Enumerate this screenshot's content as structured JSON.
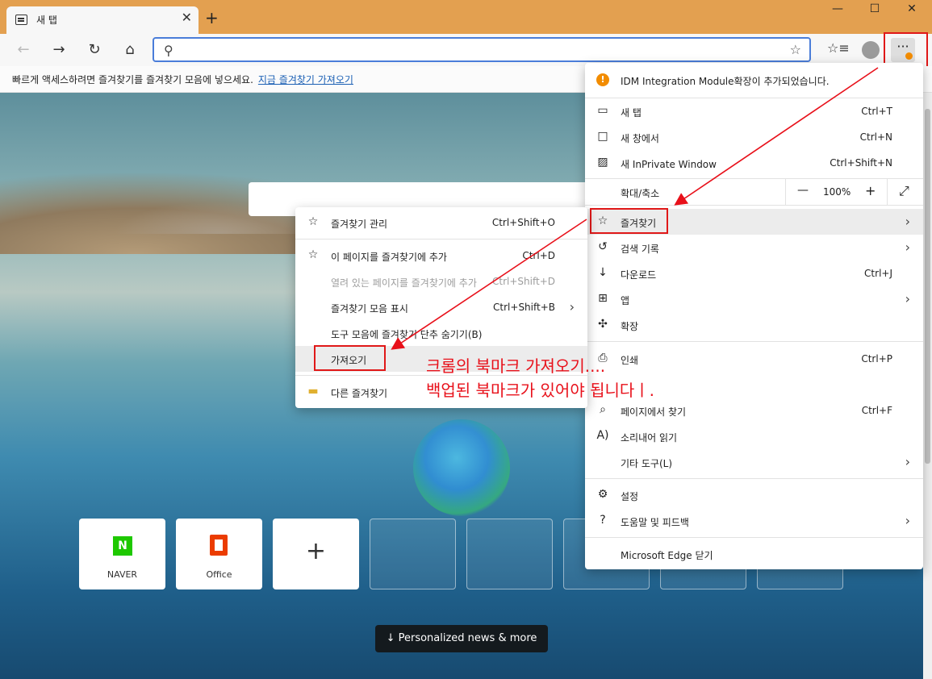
{
  "window": {
    "tab_title": "새 탭",
    "close": "✕",
    "new_tab": "+",
    "minimize": "—",
    "maximize": "☐",
    "close_window": "✕"
  },
  "toolbar": {
    "address_value": "",
    "more": "···"
  },
  "favorites_bar": {
    "message": "빠르게 액세스하려면 즐겨찾기를 즐겨찾기 모음에 넣으세요.",
    "link": "지금 즐겨찾기 가져오기"
  },
  "tiles": [
    {
      "label": "NAVER",
      "logo_text": "N"
    },
    {
      "label": "Office"
    },
    {
      "label": "+"
    }
  ],
  "news_button": "↓  Personalized news & more",
  "main_menu": {
    "notification": "IDM Integration Module확장이 추가되었습니다.",
    "items": [
      {
        "label": "새 탭",
        "shortcut": "Ctrl+T",
        "icon": "new-tab-icon"
      },
      {
        "label": "새 창에서",
        "shortcut": "Ctrl+N",
        "icon": "window-icon"
      },
      {
        "label": "새 InPrivate Window",
        "shortcut": "Ctrl+Shift+N",
        "icon": "inprivate-icon"
      },
      {
        "label": "확대/축소",
        "zoom_minus": "—",
        "zoom_value": "100%",
        "zoom_plus": "+",
        "fullscreen": "⤢"
      },
      {
        "label": "즐겨찾기",
        "icon": "favorites-icon"
      },
      {
        "label": "검색 기록",
        "icon": "history-icon"
      },
      {
        "label": "다운로드",
        "shortcut": "Ctrl+J",
        "icon": "download-icon"
      },
      {
        "label": "앱",
        "icon": "apps-icon"
      },
      {
        "label": "확장",
        "icon": "extensions-icon"
      },
      {
        "label": "인쇄",
        "shortcut": "Ctrl+P",
        "icon": "print-icon"
      },
      {
        "label": "페이지에서 찾기",
        "shortcut": "Ctrl+F",
        "icon": "find-icon"
      },
      {
        "label": "소리내어 읽기",
        "icon": "read-aloud-icon"
      },
      {
        "label": "기타 도구(L)"
      },
      {
        "label": "설정",
        "icon": "settings-icon"
      },
      {
        "label": "도움말 및 피드백",
        "icon": "help-icon"
      },
      {
        "label": "Microsoft Edge 닫기"
      }
    ]
  },
  "fav_menu": {
    "items": [
      {
        "label": "즐겨찾기 관리",
        "shortcut": "Ctrl+Shift+O"
      },
      {
        "label": "이 페이지를 즐겨찾기에 추가",
        "shortcut": "Ctrl+D"
      },
      {
        "label": "열려 있는 페이지를 즐겨찾기에 추가",
        "shortcut": "Ctrl+Shift+D"
      },
      {
        "label": "즐겨찾기 모음 표시",
        "shortcut": "Ctrl+Shift+B"
      },
      {
        "label": "도구 모음에 즐겨찾기 단추 숨기기(B)"
      },
      {
        "label": "가져오기"
      },
      {
        "label": "다른 즐겨찾기"
      }
    ]
  },
  "annotation": {
    "line1": "크롬의 북마크 가져오기....",
    "line2": "백업된 북마크가 있어야 됩니다ㅣ."
  },
  "colors": {
    "title_bar": "#e3a050",
    "accent": "#4a7dd9",
    "annotation_red": "#e8101a"
  }
}
